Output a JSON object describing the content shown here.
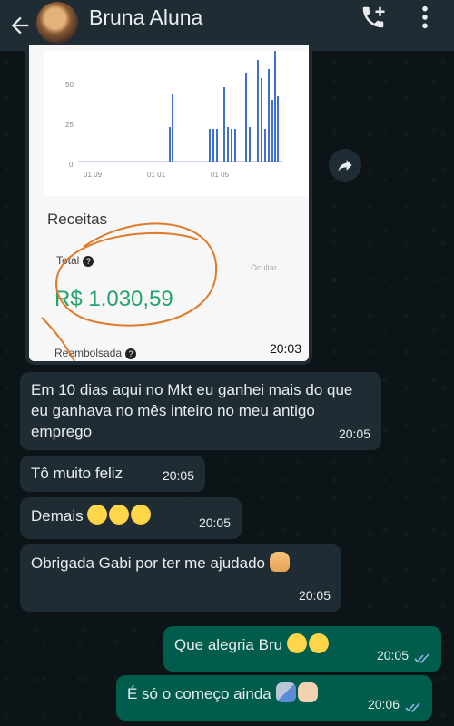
{
  "header": {
    "contact_name": "Bruna Aluna"
  },
  "image_message": {
    "receitas_label": "Receitas",
    "total_label": "Total",
    "ocultar_label": "Ocultar",
    "total_value": "R$ 1.030,59",
    "reembolsada_label": "Reembolsada",
    "time": "20:03",
    "chart": {
      "y_ticks": [
        "50",
        "25",
        "0"
      ],
      "x_ticks": [
        "01 09",
        "01 01",
        "01 05"
      ]
    }
  },
  "messages": [
    {
      "direction": "in",
      "text": "Em 10 dias aqui no Mkt eu ganhei mais do que eu ganhava no mês inteiro no meu antigo emprego",
      "time": "20:05"
    },
    {
      "direction": "in",
      "text": "Tô muito feliz",
      "time": "20:05"
    },
    {
      "direction": "in",
      "text": "Demais",
      "time": "20:05",
      "emoji": "heart-eyes x3"
    },
    {
      "direction": "in",
      "text": "Obrigada Gabi por ter me ajudado",
      "time": "20:05",
      "emoji": "folded-hands"
    },
    {
      "direction": "out",
      "text": "Que alegria Bru",
      "time": "20:05",
      "emoji": "star-struck x2"
    },
    {
      "direction": "out",
      "text": "É só o começo ainda",
      "time": "20:06",
      "emoji": "rocket fist"
    }
  ],
  "colors": {
    "header_bg": "#1f2c33",
    "incoming_bubble": "#1f2c33",
    "outgoing_bubble": "#005c4b",
    "value_green": "#22a36b",
    "circle_orange": "#e07b2a",
    "bar_blue": "#3d6fd6"
  }
}
